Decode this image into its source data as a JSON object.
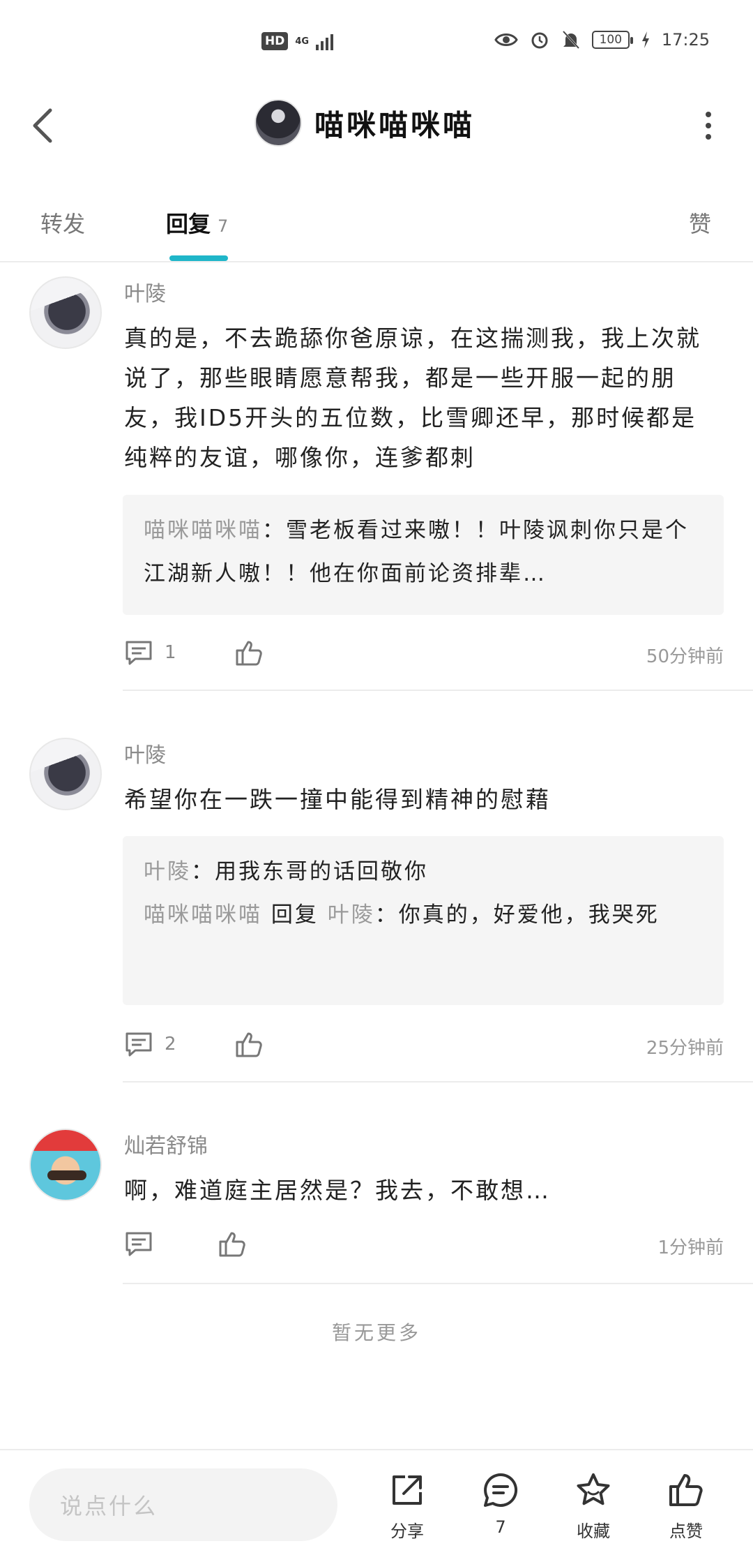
{
  "status_bar": {
    "hd": "HD",
    "network": "4G",
    "battery": "100",
    "time": "17:25"
  },
  "header": {
    "title": "喵咪喵咪喵"
  },
  "tabs": {
    "forward": "转发",
    "reply": "回复",
    "reply_count": "7",
    "like": "赞"
  },
  "comments": [
    {
      "author": "叶陵",
      "text": "真的是，不去跪舔你爸原谅，在这揣测我，我上次就说了，那些眼睛愿意帮我，都是一些开服一起的朋友，我ID5开头的五位数，比雪卿还早，那时候都是纯粹的友谊，哪像你，连爹都刺",
      "quote_lines": [
        {
          "name": "喵咪喵咪喵",
          "sep": "：",
          "text": "雪老板看过来嗷！！叶陵讽刺你只是个江湖新人嗷！！他在你面前论资排辈…"
        }
      ],
      "reply_count": "1",
      "time": "50分钟前"
    },
    {
      "author": "叶陵",
      "text": "希望你在一跌一撞中能得到精神的慰藉",
      "quote_lines": [
        {
          "name": "叶陵",
          "sep": "：",
          "text": "用我东哥的话回敬你"
        },
        {
          "name": "喵咪喵咪喵",
          "mid": " 回复 ",
          "name2": "叶陵",
          "sep": "：",
          "text": "你真的，好爱他，我哭死"
        }
      ],
      "reply_count": "2",
      "time": "25分钟前"
    },
    {
      "author": "灿若舒锦",
      "text": "啊，难道庭主居然是？我去，不敢想…",
      "reply_count": "",
      "time": "1分钟前"
    }
  ],
  "no_more": "暂无更多",
  "bottom_bar": {
    "input_placeholder": "说点什么",
    "share": "分享",
    "comments": "7",
    "favorite": "收藏",
    "like": "点赞"
  }
}
